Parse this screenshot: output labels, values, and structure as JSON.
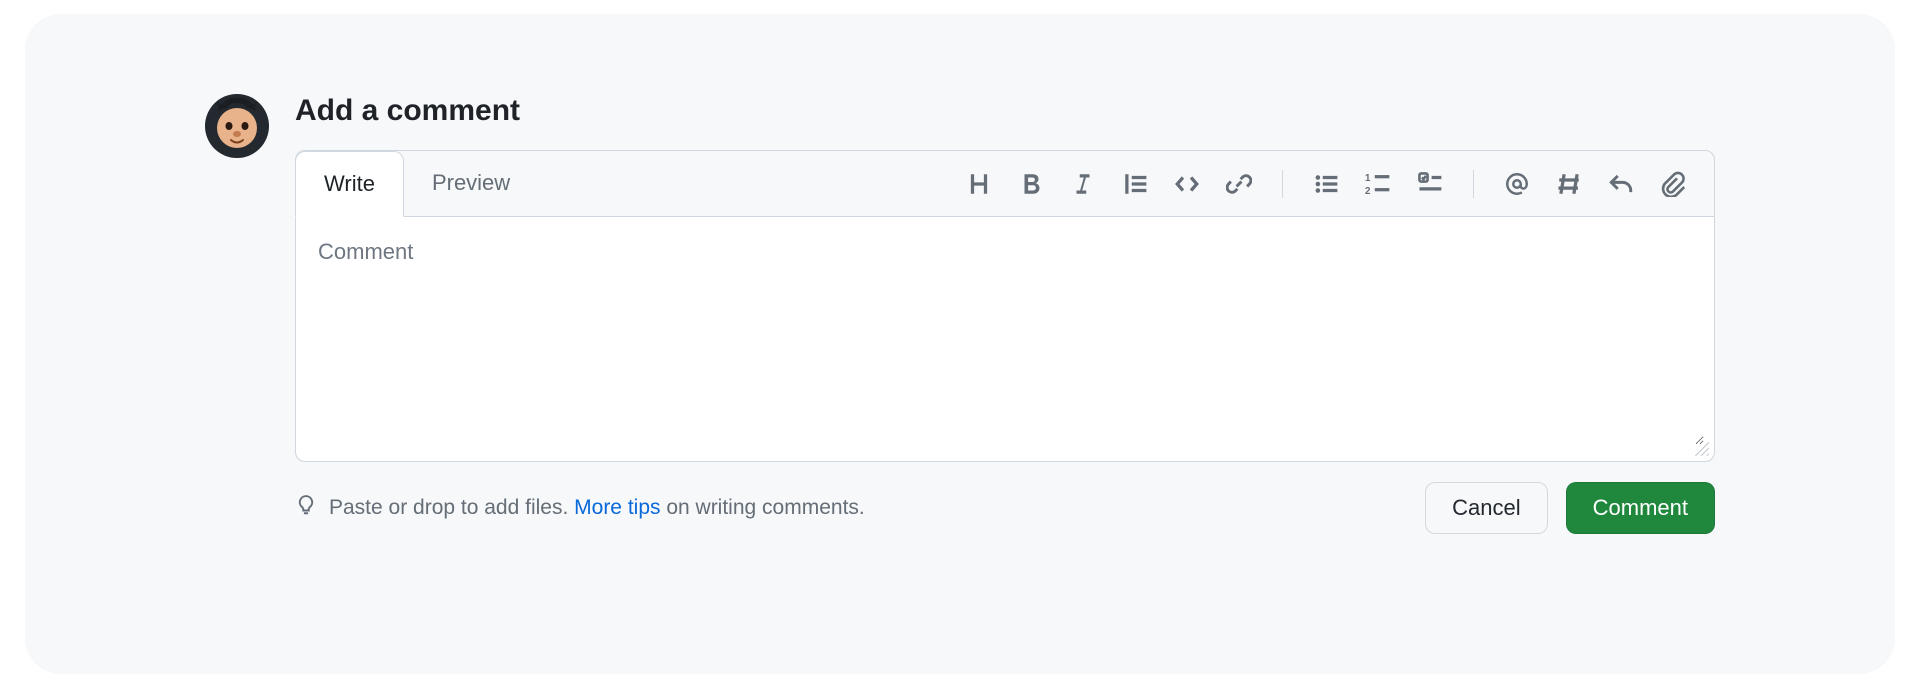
{
  "header": {
    "title": "Add a comment"
  },
  "tabs": {
    "write": "Write",
    "preview": "Preview",
    "active": "write"
  },
  "toolbar": {
    "heading": "Heading",
    "bold": "Bold",
    "italic": "Italic",
    "quote": "Quote",
    "code": "Code",
    "link": "Link",
    "ul": "Unordered list",
    "ol": "Numbered list",
    "tasklist": "Task list",
    "mention": "Mention",
    "reference": "Reference",
    "reply": "Reply",
    "attach": "Attach files"
  },
  "editor": {
    "placeholder": "Comment",
    "value": ""
  },
  "tips": {
    "prefix": "Paste or drop to add files. ",
    "link": "More tips",
    "suffix": " on writing comments."
  },
  "actions": {
    "cancel": "Cancel",
    "submit": "Comment"
  },
  "colors": {
    "accent": "#1f883d",
    "link": "#0969da",
    "border": "#d0d7de",
    "muted": "#656d76",
    "bg_subtle": "#f6f8fa"
  }
}
